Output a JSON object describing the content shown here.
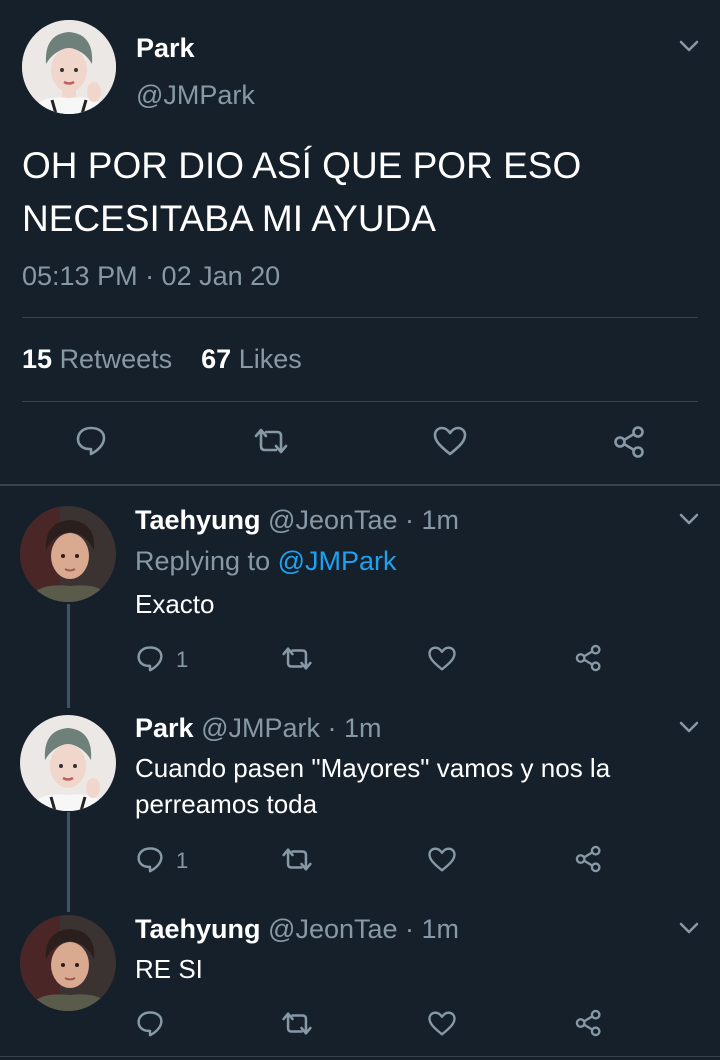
{
  "main_tweet": {
    "display_name": "Park",
    "handle": "@JMPark",
    "text_line1": "OH POR DIO ASÍ QUE POR ESO",
    "text_line2": "NECESITABA MI AYUDA",
    "timestamp": "05:13 PM · 02 Jan 20",
    "retweet_count": "15",
    "retweet_label": "Retweets",
    "like_count": "67",
    "like_label": "Likes"
  },
  "replies": [
    {
      "display_name": "Taehyung",
      "handle": "@JeonTae",
      "time": "· 1m",
      "replying_prefix": "Replying to",
      "replying_handle": "@JMPark",
      "text": "Exacto",
      "reply_count": "1"
    },
    {
      "display_name": "Park",
      "handle": "@JMPark",
      "time": "· 1m",
      "text_line1": "Cuando pasen \"Mayores\" vamos y nos la",
      "text_line2": "perreamos toda",
      "reply_count": "1"
    },
    {
      "display_name": "Taehyung",
      "handle": "@JeonTae",
      "time": "· 1m",
      "text": "RE SI",
      "reply_count": ""
    }
  ],
  "icons": [
    "reply-icon",
    "retweet-icon",
    "like-icon",
    "share-icon",
    "chevron-down-icon"
  ],
  "colors": {
    "background": "#15202b",
    "secondary_text": "#8899a6",
    "link": "#1da1f2",
    "divider": "#38444d"
  }
}
